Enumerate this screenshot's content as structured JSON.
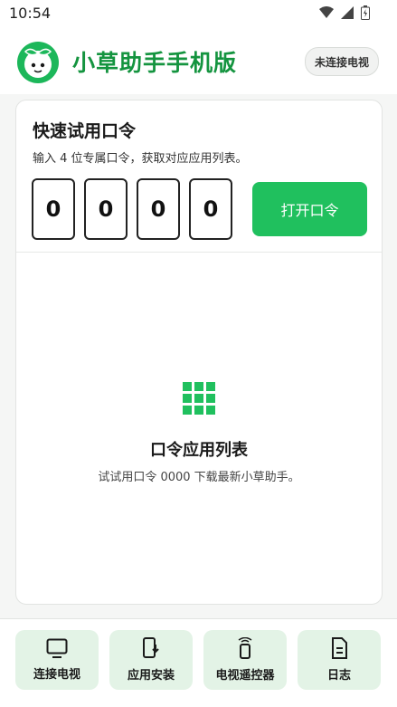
{
  "status": {
    "time": "10:54"
  },
  "header": {
    "title": "小草助手手机版",
    "connection_badge": "未连接电视"
  },
  "card": {
    "title": "快速试用口令",
    "subtitle": "输入 4 位专属口令，获取对应应用列表。",
    "code_digits": [
      "0",
      "0",
      "0",
      "0"
    ],
    "open_button": "打开口令",
    "empty_title": "口令应用列表",
    "empty_subtitle": "试试用口令 0000 下载最新小草助手。"
  },
  "bottom_nav": [
    {
      "label": "连接电视",
      "icon": "tv-icon"
    },
    {
      "label": "应用安装",
      "icon": "phone-install-icon"
    },
    {
      "label": "电视遥控器",
      "icon": "remote-icon"
    },
    {
      "label": "日志",
      "icon": "log-icon"
    }
  ],
  "colors": {
    "brand_green": "#20c05e",
    "title_green": "#14943f",
    "nav_bg": "#e3f3e6"
  }
}
